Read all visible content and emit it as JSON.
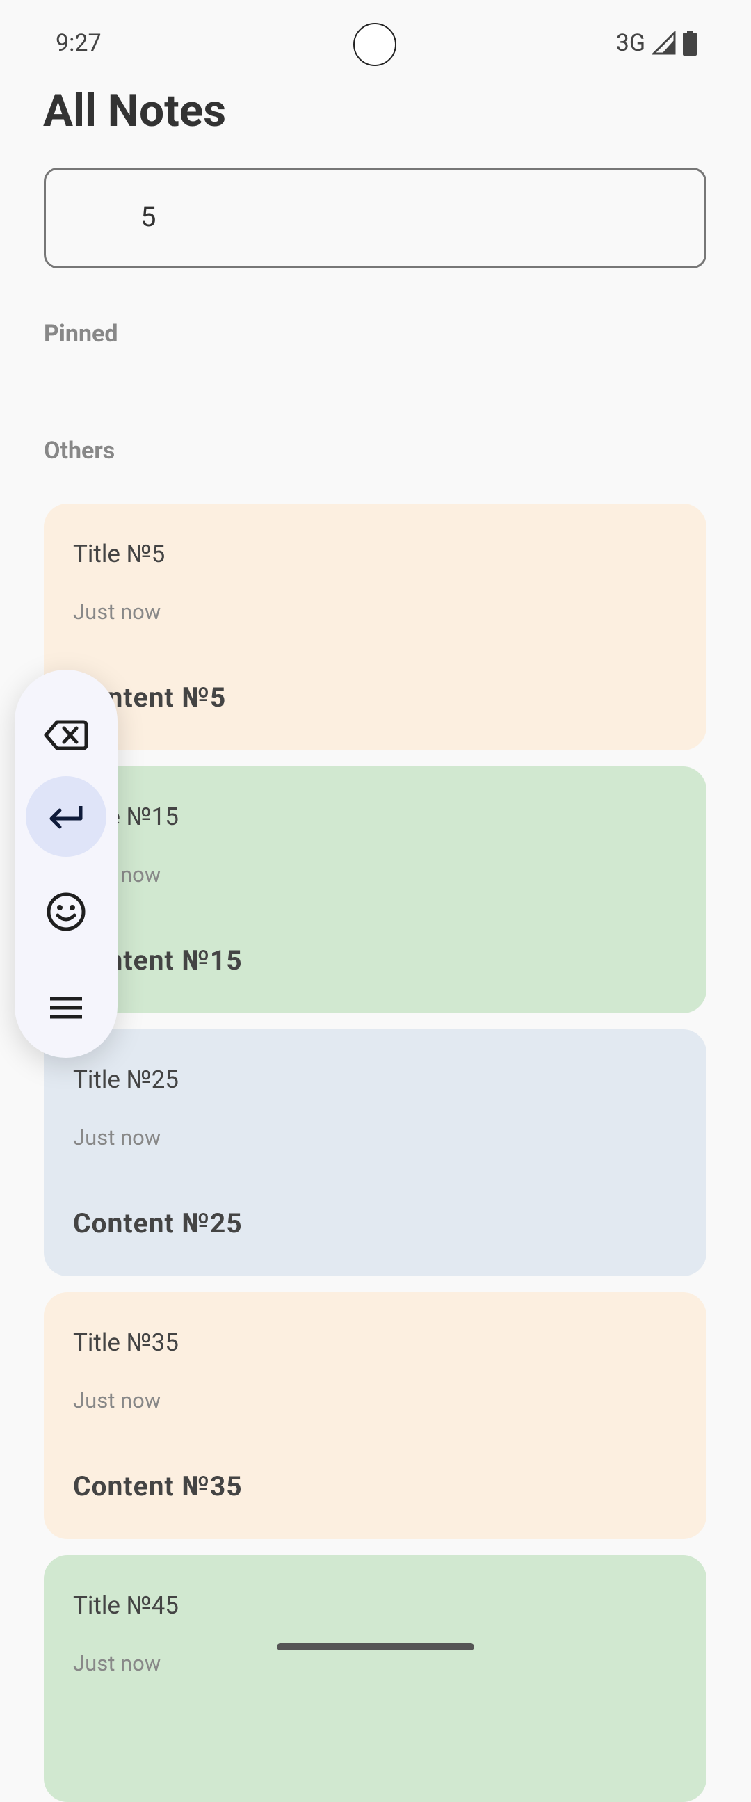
{
  "status": {
    "time": "9:27",
    "network": "3G"
  },
  "header": {
    "title": "All Notes"
  },
  "search": {
    "value": "5"
  },
  "sections": {
    "pinned": "Pinned",
    "others": "Others"
  },
  "notes": [
    {
      "title": "Title №5",
      "time": "Just now",
      "content": "Content №5",
      "color": "#fcefe0"
    },
    {
      "title": "Title №15",
      "time": "Just now",
      "content": "Content №15",
      "color": "#d1e8d0"
    },
    {
      "title": "Title №25",
      "time": "Just now",
      "content": "Content №25",
      "color": "#e2e9f1"
    },
    {
      "title": "Title №35",
      "time": "Just now",
      "content": "Content №35",
      "color": "#fcefe0"
    },
    {
      "title": "Title №45",
      "time": "Just now",
      "content": "",
      "color": "#d1e8d0"
    }
  ],
  "toolbar": {
    "icons": [
      "backspace-icon",
      "enter-icon",
      "emoji-icon",
      "menu-icon"
    ]
  }
}
